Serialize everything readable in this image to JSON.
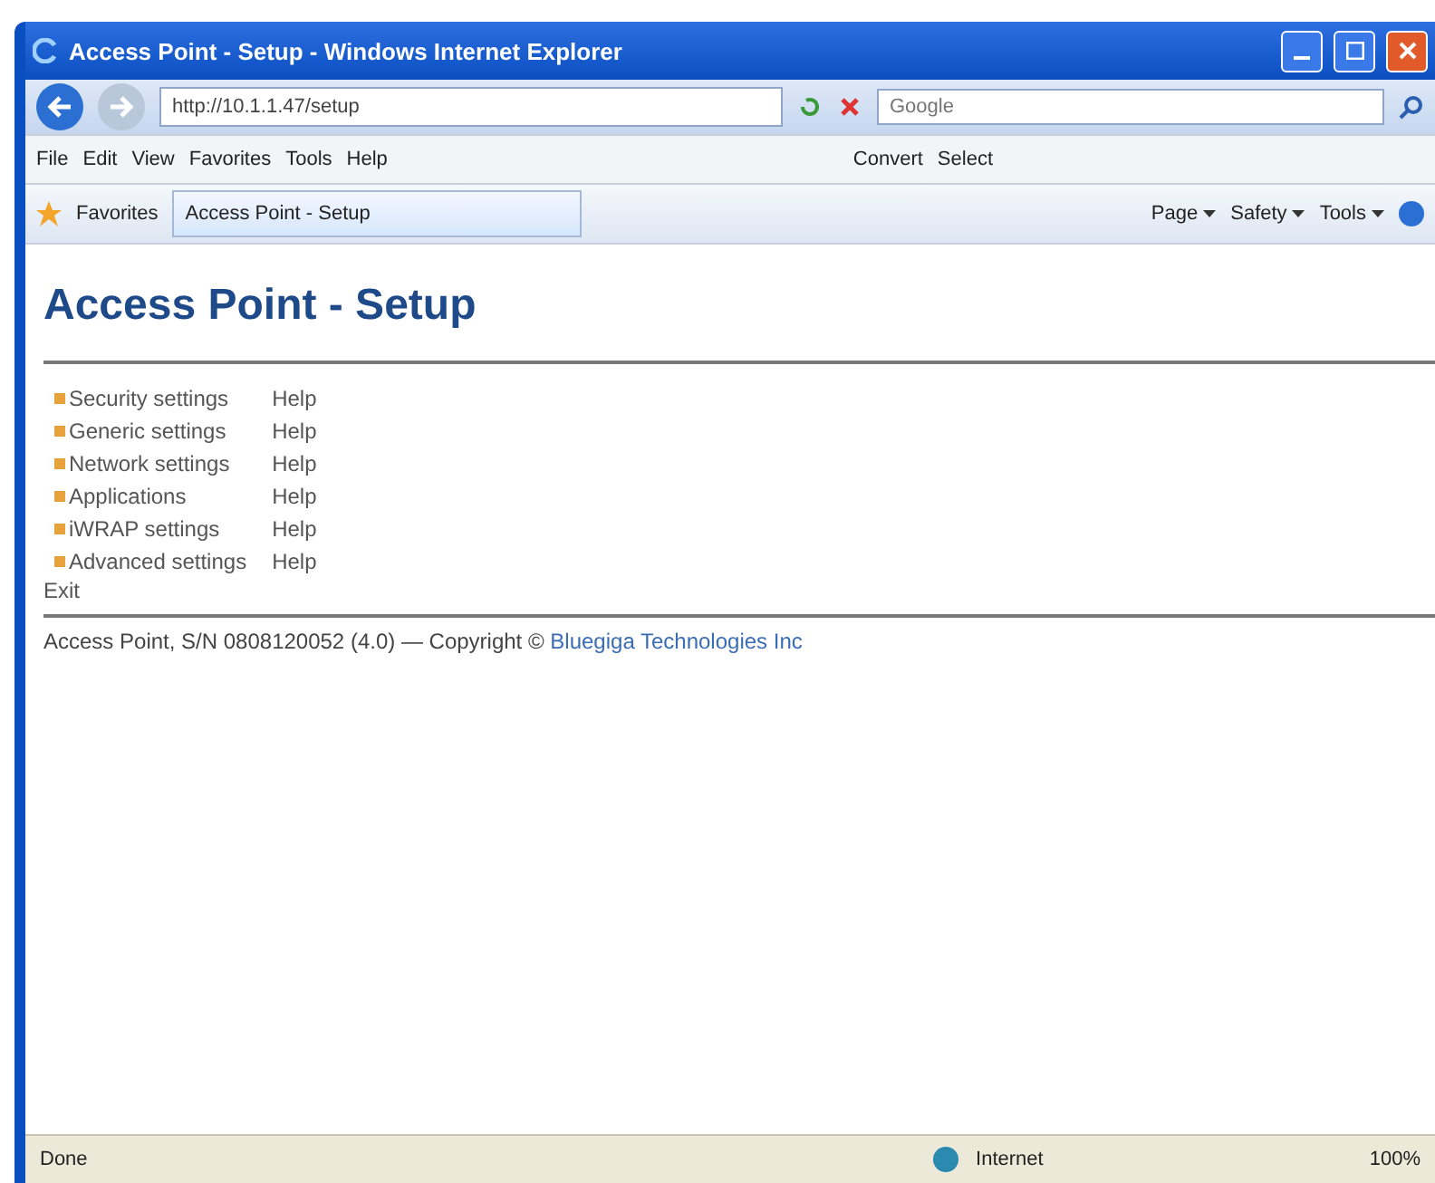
{
  "window": {
    "title": "Access Point - Setup - Windows Internet Explorer"
  },
  "address_bar": {
    "value": "http://10.1.1.47/setup"
  },
  "search": {
    "placeholder": "Google"
  },
  "menu": [
    "File",
    "Edit",
    "View",
    "Favorites",
    "Tools",
    "Help"
  ],
  "addons": [
    "Convert",
    "Select"
  ],
  "favorites": {
    "label": "Favorites"
  },
  "tab": {
    "label": "Access Point - Setup",
    "selected": true
  },
  "command_bar": [
    "Page",
    "Safety",
    "Tools"
  ],
  "page": {
    "heading": "Access Point - Setup",
    "links": [
      {
        "label": "Security settings",
        "help": "Help"
      },
      {
        "label": "Generic settings",
        "help": "Help"
      },
      {
        "label": "Network settings",
        "help": "Help"
      },
      {
        "label": "Applications",
        "help": "Help"
      },
      {
        "label": "iWRAP settings",
        "help": "Help"
      },
      {
        "label": "Advanced settings",
        "help": "Help"
      }
    ],
    "exit": "Exit",
    "footer": "Access Point, S/N 0808120052 (4.0) — Copyright © ",
    "footer_link": "Bluegiga Technologies Inc"
  },
  "status_bar": {
    "status": "Done",
    "zone": "Internet",
    "zoom": "100%"
  }
}
